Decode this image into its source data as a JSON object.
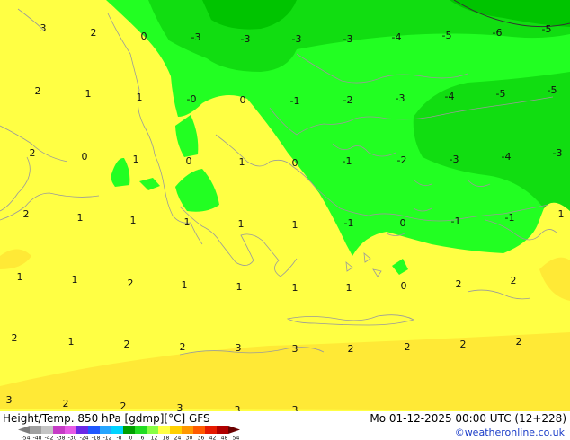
{
  "title": "Height/Temp. 850 hPa [gdmp][°C] GFS",
  "run_info": "Mo 01-12-2025 00:00 UTC (12+228)",
  "credit": "©weatheronline.co.uk",
  "colors": {
    "yellow": "#ffff44",
    "orange_tint": "#ffe936",
    "green_light": "#22ff22",
    "green_mid": "#11dd11",
    "green_dark": "#00c400",
    "green_darkest": "#009e00"
  },
  "colorbar": {
    "ticks": [
      "-54",
      "-48",
      "-42",
      "-38",
      "-30",
      "-24",
      "-18",
      "-12",
      "-8",
      "0",
      "6",
      "12",
      "18",
      "24",
      "30",
      "36",
      "42",
      "48",
      "54"
    ],
    "colors": [
      "#7d7d7d",
      "#a0a0a0",
      "#c4c4c4",
      "#c63cc6",
      "#e65ae6",
      "#6a28e6",
      "#2058ff",
      "#26a6ff",
      "#00d4ff",
      "#00a000",
      "#22dd22",
      "#88ff44",
      "#ffff44",
      "#ffd000",
      "#ff9800",
      "#ff5a00",
      "#e61a00",
      "#b00000",
      "#6a0000"
    ]
  },
  "temp_labels": [
    {
      "text": "3"
    },
    {
      "text": "2"
    },
    {
      "text": "0"
    },
    {
      "text": "-3"
    },
    {
      "text": "-3"
    },
    {
      "text": "-3"
    },
    {
      "text": "-3"
    },
    {
      "text": "-4"
    },
    {
      "text": "-5"
    },
    {
      "text": "-6"
    },
    {
      "text": "-5"
    },
    {
      "text": "2"
    },
    {
      "text": "1"
    },
    {
      "text": "1"
    },
    {
      "text": "-0"
    },
    {
      "text": "0"
    },
    {
      "text": "-1"
    },
    {
      "text": "-2"
    },
    {
      "text": "-3"
    },
    {
      "text": "-4"
    },
    {
      "text": "-5"
    },
    {
      "text": "-5"
    },
    {
      "text": "2"
    },
    {
      "text": "0"
    },
    {
      "text": "1"
    },
    {
      "text": "0"
    },
    {
      "text": "1"
    },
    {
      "text": "0"
    },
    {
      "text": "-1"
    },
    {
      "text": "-2"
    },
    {
      "text": "-3"
    },
    {
      "text": "-4"
    },
    {
      "text": "-3"
    },
    {
      "text": "2"
    },
    {
      "text": "1"
    },
    {
      "text": "1"
    },
    {
      "text": "1"
    },
    {
      "text": "1"
    },
    {
      "text": "1"
    },
    {
      "text": "-1"
    },
    {
      "text": "0"
    },
    {
      "text": "-1"
    },
    {
      "text": "-1"
    },
    {
      "text": "1"
    },
    {
      "text": "1"
    },
    {
      "text": "1"
    },
    {
      "text": "2"
    },
    {
      "text": "1"
    },
    {
      "text": "1"
    },
    {
      "text": "1"
    },
    {
      "text": "1"
    },
    {
      "text": "0"
    },
    {
      "text": "2"
    },
    {
      "text": "2"
    },
    {
      "text": "2"
    },
    {
      "text": "1"
    },
    {
      "text": "2"
    },
    {
      "text": "2"
    },
    {
      "text": "3"
    },
    {
      "text": "3"
    },
    {
      "text": "2"
    },
    {
      "text": "2"
    },
    {
      "text": "2"
    },
    {
      "text": "2"
    },
    {
      "text": "3"
    },
    {
      "text": "2"
    },
    {
      "text": "2"
    },
    {
      "text": "3"
    },
    {
      "text": "3"
    },
    {
      "text": "3"
    }
  ]
}
